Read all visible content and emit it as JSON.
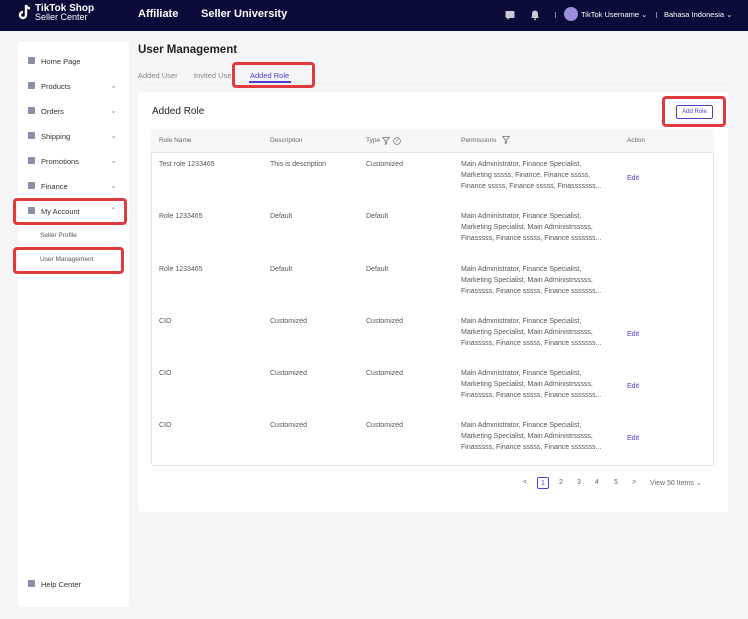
{
  "topbar": {
    "logo_line1": "TikTok Shop",
    "logo_line2": "Seller Center",
    "nav": [
      "Affiliate",
      "Seller University"
    ],
    "username": "TikTok Username ⌄",
    "language": "Bahasa Indonesia ⌄"
  },
  "sidebar": {
    "items": [
      {
        "label": "Home Page",
        "chevron": ""
      },
      {
        "label": "Products",
        "chevron": "⌄"
      },
      {
        "label": "Orders",
        "chevron": "⌄"
      },
      {
        "label": "Shipping",
        "chevron": "⌄"
      },
      {
        "label": "Promotions",
        "chevron": "⌄"
      },
      {
        "label": "Finance",
        "chevron": "⌄"
      },
      {
        "label": "My Account",
        "chevron": "⌃"
      }
    ],
    "sub_items": [
      "Seller Profile",
      "User Management"
    ],
    "help": "Help Center"
  },
  "page": {
    "title": "User Management",
    "tabs": [
      "Added User",
      "Invited User",
      "Added Role"
    ],
    "card_title": "Added Role",
    "add_button": "Add Role"
  },
  "table": {
    "headers": [
      "Role Name",
      "Description",
      "Type",
      "Permissions",
      "Action"
    ],
    "rows": [
      {
        "name": "Test role 1233465",
        "desc": "This is description",
        "type": "Customized",
        "perm": [
          "Main Administrator, Finance Specialist,",
          "Marketing sssss, Finance, Finance sssss,",
          "Finance sssss, Finance sssss, Finasssssss..."
        ],
        "action": "Edit"
      },
      {
        "name": "Role 1233465",
        "desc": "Default",
        "type": "Default",
        "perm": [
          "Main Administrator, Finance Specialist,",
          "Marketing Specialist, Main Administrsssss,",
          "Finasssss, Finance sssss, Finance sssssss..."
        ],
        "action": ""
      },
      {
        "name": "Role 1233465",
        "desc": "Default",
        "type": "Default",
        "perm": [
          "Main Administrator, Finance Specialist,",
          "Marketing Specialist, Main Administrsssss,",
          "Finasssss, Finance sssss, Finance sssssss..."
        ],
        "action": ""
      },
      {
        "name": "CIO",
        "desc": "Customized",
        "type": "Customized",
        "perm": [
          "Main Administrator, Finance Specialist,",
          "Marketing Specialist, Main Administrsssss,",
          "Finasssss, Finance sssss, Finance sssssss..."
        ],
        "action": "Edit"
      },
      {
        "name": "CIO",
        "desc": "Customized",
        "type": "Customized",
        "perm": [
          "Main Administrator, Finance Specialist,",
          "Marketing Specialist, Main Administrsssss,",
          "Finasssss, Finance sssss, Finance sssssss..."
        ],
        "action": "Edit"
      },
      {
        "name": "CIO",
        "desc": "Customized",
        "type": "Customized",
        "perm": [
          "Main Administrator, Finance Specialist,",
          "Marketing Specialist, Main Administrsssss,",
          "Finasssss, Finance sssss, Finance sssssss..."
        ],
        "action": "Edit"
      }
    ]
  },
  "pagination": {
    "prev": "<",
    "pages": [
      "1",
      "2",
      "3",
      "4",
      "5"
    ],
    "next": ">",
    "view": "View 50 Items ⌄"
  },
  "colors": {
    "accent": "#4b3fd6",
    "topbar": "#0b0b3a",
    "highlight": "#e0393e"
  }
}
